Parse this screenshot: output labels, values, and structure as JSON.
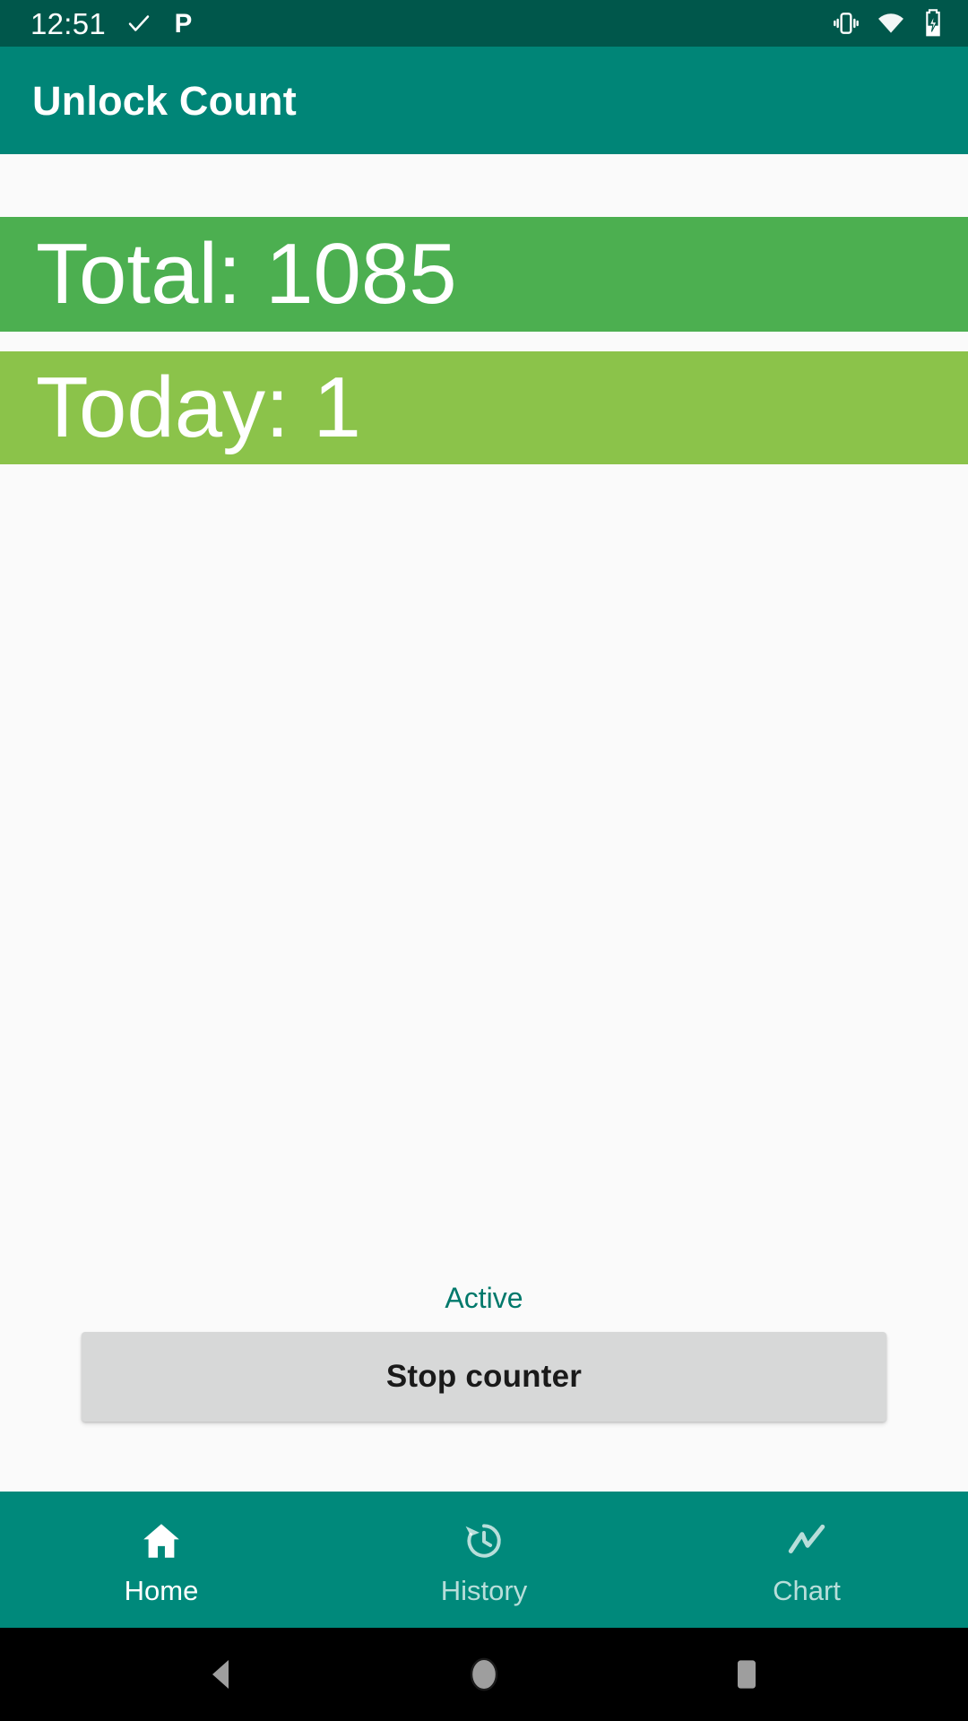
{
  "status_bar": {
    "time": "12:51",
    "left_icons": [
      "check-icon",
      "p-app-icon"
    ],
    "right_icons": [
      "vibrate-icon",
      "wifi-icon",
      "battery-charging-icon"
    ],
    "background": "#00574B"
  },
  "app_bar": {
    "title": "Unlock Count",
    "background": "#008577"
  },
  "stats": {
    "total": {
      "label": "Total: 1085",
      "value": 1085,
      "color": "#4CAF50"
    },
    "today": {
      "label": "Today: 1",
      "value": 1,
      "color": "#8BC34A"
    }
  },
  "counter": {
    "status_text": "Active",
    "status_color": "#00796B",
    "button_label": "Stop counter",
    "button_color": "#D7D8D8"
  },
  "bottom_nav": {
    "background": "#00897B",
    "items": [
      {
        "label": "Home",
        "icon": "home-icon",
        "active": true
      },
      {
        "label": "History",
        "icon": "history-icon",
        "active": false
      },
      {
        "label": "Chart",
        "icon": "line-chart-icon",
        "active": false
      }
    ]
  },
  "system_nav": {
    "buttons": [
      "back-icon",
      "home-circle-icon",
      "recents-square-icon"
    ]
  }
}
